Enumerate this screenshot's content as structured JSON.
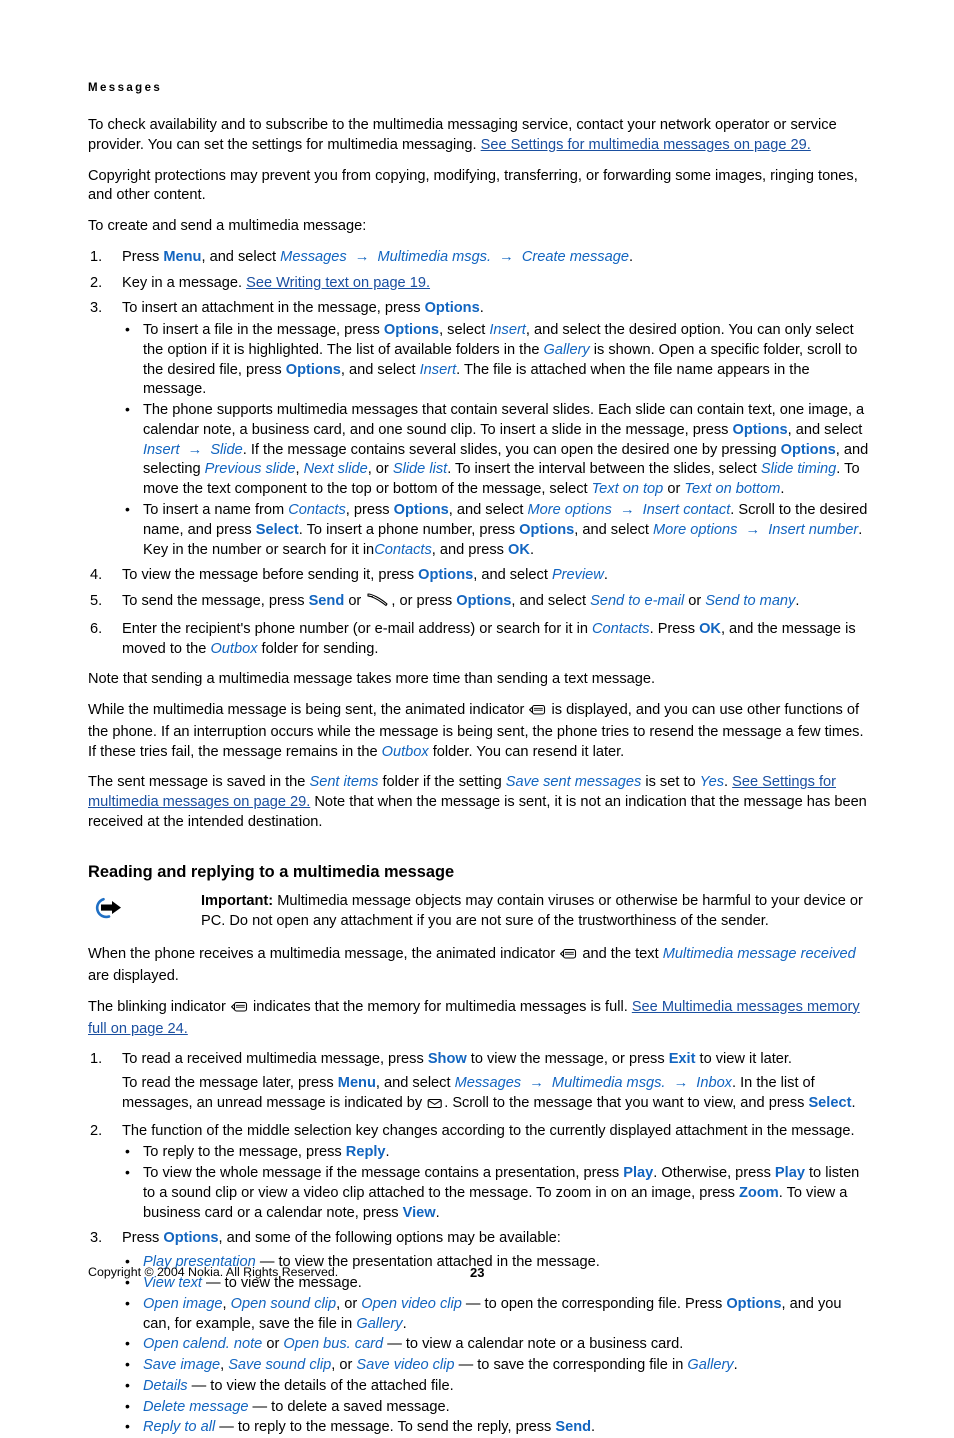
{
  "document": {
    "chapter": "Messages",
    "page_number": "23",
    "copyright": "Copyright © 2004 Nokia. All Rights Reserved."
  },
  "intro": {
    "p1_a": "To check availability and to subscribe to the multimedia messaging service, contact your network operator or service provider. You can set the settings for multimedia messaging. ",
    "p1_link": "See Settings for multimedia messages on page 29.",
    "p2": "Copyright protections may prevent you from copying, modifying, transferring, or forwarding some images, ringing tones, and other content.",
    "p3": "To create and send a multimedia message:"
  },
  "steps": {
    "s1": {
      "t1": "Press ",
      "menu": "Menu",
      "t2": ", and select ",
      "messages": "Messages",
      "arrow1": "→",
      "mms": "Multimedia msgs.",
      "arrow2": "→",
      "create": "Create message",
      "t3": "."
    },
    "s2": {
      "t1": "Key in a message. ",
      "link": "See Writing text on page 19."
    },
    "s3": {
      "t1": "To insert an attachment in the message, press ",
      "options": "Options",
      "t2": ".",
      "b1": {
        "t1": "To insert a file in the message, press ",
        "options1": "Options",
        "t2": ", select ",
        "insert1": "Insert",
        "t3": ", and select the desired option. You can only select the option if it is highlighted. The list of available folders in the ",
        "gallery": "Gallery",
        "t4": " is shown. Open a specific folder, scroll to the desired file, press ",
        "options2": "Options",
        "t5": ", and select ",
        "insert2": "Insert",
        "t6": ". The file is attached when the file name appears in the message."
      },
      "b2": {
        "t1": "The phone supports multimedia messages that contain several slides. Each slide can contain text, one image, a calendar note, a business card, and one sound clip. To insert a slide in the message, press ",
        "options1": "Options",
        "t2": ", and select ",
        "insert": "Insert",
        "arrow1": "→",
        "slide": "Slide",
        "t3": ". If the message contains several slides, you can open the desired one by pressing ",
        "options2": "Options",
        "t4": ", and selecting ",
        "prev": "Previous slide",
        "t5": ", ",
        "next": "Next slide",
        "t6": ", or ",
        "slidelist": "Slide list",
        "t7": ". To insert the interval between the slides, select ",
        "timing": "Slide timing",
        "t8": ". To move the text component to the top or bottom of the message, select ",
        "texttop": "Text on top",
        "t9": " or ",
        "textbottom": "Text on bottom",
        "t10": "."
      },
      "b3": {
        "t1": "To insert a name from ",
        "contacts1": "Contacts",
        "t2": ", press ",
        "options1": "Options",
        "t3": ", and select ",
        "more1": "More options",
        "arrow1": "→",
        "insertcontact": "Insert contact",
        "t4": ". Scroll to the desired name, and press ",
        "select": "Select",
        "t5": ". To insert a phone number, press ",
        "options2": "Options",
        "t6": ", and select ",
        "more2": "More options",
        "arrow2": "→",
        "insertnumber": "Insert number",
        "t7": ". Key in the number or search for it in",
        "contacts2": "Contacts",
        "t8": ", and press ",
        "ok": "OK",
        "t9": "."
      }
    },
    "s4": {
      "t1": "To view the message before sending it, press ",
      "options": "Options",
      "t2": ", and select ",
      "preview": "Preview",
      "t3": "."
    },
    "s5": {
      "t1": "To send the message, press ",
      "send": "Send",
      "t2": " or ",
      "icon": "call-key-icon",
      "t3": ", or press ",
      "options": "Options",
      "t4": ", and select ",
      "sendemail": "Send to e-mail",
      "t5": " or ",
      "sendmany": "Send to many",
      "t6": "."
    },
    "s6": {
      "t1": "Enter the recipient's phone number (or e-mail address) or search for it in ",
      "contacts": "Contacts",
      "t2": ". Press ",
      "ok": "OK",
      "t3": ", and the message is moved to the ",
      "outbox": "Outbox",
      "t4": " folder for sending."
    }
  },
  "mid": {
    "note": "Note that sending a multimedia message takes more time than sending a text message.",
    "sending_a": "While the multimedia message is being sent, the animated indicator ",
    "sending_icon": "envelope-indicator-icon",
    "sending_b": " is displayed, and you can use other functions of the phone. If an interruption occurs while the message is being sent, the phone tries to resend the message a few times. If these tries fail, the message remains in the ",
    "outbox": "Outbox",
    "sending_c": " folder. You can resend it later.",
    "saved_a": "The sent message is saved in the ",
    "sent_items": "Sent items",
    "saved_b": " folder if the setting ",
    "save_sent": "Save sent messages",
    "saved_c": " is set to ",
    "yes": "Yes",
    "saved_d": ". ",
    "saved_link": "See Settings for multimedia messages on page 29.",
    "saved_e": " Note that when the message is sent, it is not an indication that the message has been received at the intended destination."
  },
  "reading": {
    "heading": "Reading and replying to a multimedia message",
    "important_label": "Important:",
    "important_text": " Multimedia message objects may contain viruses or otherwise be harmful to your device or PC. Do not open any attachment if you are not sure of the trustworthiness of the sender.",
    "icon": "important-circle-arrow-icon",
    "receives_a": "When the phone receives a multimedia message, the animated indicator ",
    "receives_icon": "envelope-indicator-icon",
    "receives_b": " and the text ",
    "receives_italic": "Multimedia message received",
    "receives_c": " are displayed.",
    "blink_a": "The blinking indicator ",
    "blink_icon": "envelope-indicator-icon",
    "blink_b": " indicates that the memory for multimedia messages is full. ",
    "blink_link": "See Multimedia messages memory full on page 24."
  },
  "reading_steps": {
    "r1": {
      "t1": "To read a received multimedia message, press ",
      "show": "Show",
      "t2": " to view the message, or press ",
      "exit": "Exit",
      "t3": " to view it later.",
      "sub_t1": "To read the message later, press ",
      "menu": "Menu",
      "sub_t2": ", and select ",
      "messages": "Messages",
      "arrow1": "→",
      "mms": "Multimedia msgs.",
      "arrow2": "→",
      "inbox": "Inbox",
      "sub_t3": ". In the list of messages, an unread message is indicated by ",
      "unread_icon": "unread-envelope-icon",
      "sub_t4": ". Scroll to the message that you want to view, and press ",
      "select": "Select",
      "sub_t5": "."
    },
    "r2": {
      "t1": "The function of the middle selection key changes according to the currently displayed attachment in the message.",
      "b1": {
        "t1": "To reply to the message, press ",
        "reply": "Reply",
        "t2": "."
      },
      "b2": {
        "t1": "To view the whole message if the message contains a presentation, press ",
        "play1": "Play",
        "t2": ". Otherwise, press ",
        "play2": "Play",
        "t3": " to listen to a sound clip or view a video clip attached to the message. To zoom in on an image, press ",
        "zoom": "Zoom",
        "t4": ". To view a business card or a calendar note, press ",
        "view": "View",
        "t5": "."
      }
    },
    "r3": {
      "t1": "Press ",
      "options": "Options",
      "t2": ", and some of the following options may be available:",
      "opts": [
        {
          "name": "Play presentation",
          "desc": " — to view the presentation attached in the message."
        },
        {
          "name": "View text",
          "desc": " — to view the message."
        },
        {
          "name": "Open image",
          "sep1": ", ",
          "name2": "Open sound clip",
          "sep2": ", or ",
          "name3": "Open video clip",
          "desc": " — to open the corresponding file. Press ",
          "options": "Options",
          "desc2": ", and you can, for example, save the file in ",
          "gallery": "Gallery",
          "desc3": "."
        },
        {
          "name": "Open calend. note",
          "sep1": " or ",
          "name2": "Open bus. card",
          "desc": " — to view a calendar note or a business card."
        },
        {
          "name": "Save image",
          "sep1": ", ",
          "name2": "Save sound clip",
          "sep2": ", or ",
          "name3": "Save video clip",
          "desc": " — to save the corresponding file in ",
          "gallery": "Gallery",
          "desc2": "."
        },
        {
          "name": "Details",
          "desc": " — to view the details of the attached file."
        },
        {
          "name": "Delete message",
          "desc": " — to delete a saved message."
        },
        {
          "name": "Reply to all",
          "desc": " — to reply to the message. To send the reply, press ",
          "send": "Send",
          "desc2": "."
        }
      ]
    }
  },
  "colors": {
    "ui_term": "#1265c0",
    "link": "#1a4fa0",
    "icon_blue": "#1f6fc4"
  }
}
